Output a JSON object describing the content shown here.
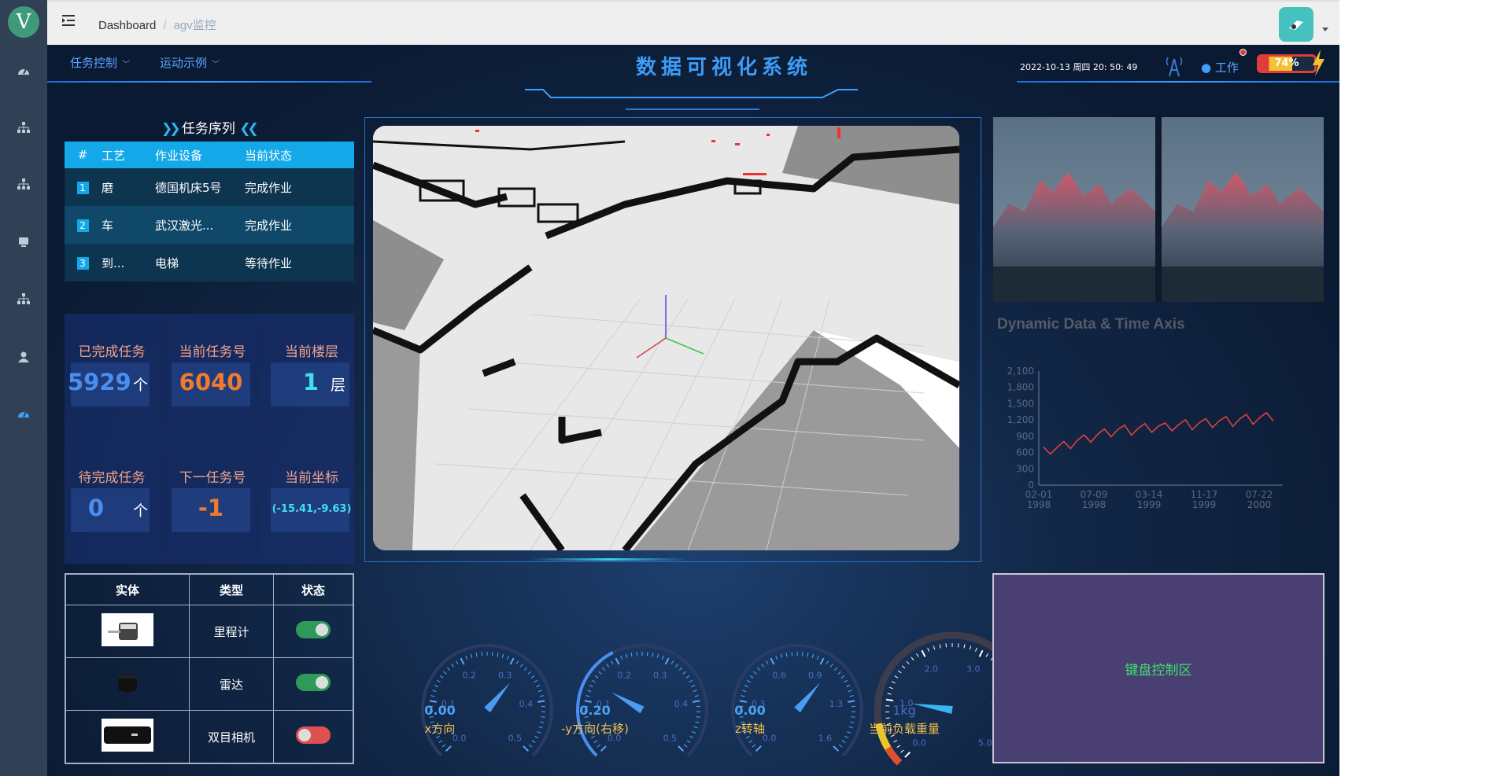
{
  "sidebar": {
    "logo_text": "V",
    "icons": [
      "dashboard-icon",
      "tree-icon",
      "tree-icon",
      "guide-icon",
      "tree-icon",
      "user-icon",
      "dashboard-icon"
    ]
  },
  "topbar": {
    "breadcrumb": [
      "Dashboard",
      "agv监控"
    ]
  },
  "header": {
    "menu_task": "任务控制",
    "menu_motion": "运动示例",
    "title": "数据可视化系统",
    "datetime": "2022-10-13 周四 20: 50: 49",
    "work_status": "工作",
    "battery": "74%",
    "battery_level": 0.74
  },
  "task_panel": {
    "title": "任务序列",
    "columns": [
      "#",
      "工艺",
      "作业设备",
      "当前状态"
    ],
    "rows": [
      {
        "no": "1",
        "process": "磨",
        "device": "德国机床5号",
        "status": "完成作业"
      },
      {
        "no": "2",
        "process": "车",
        "device": "武汉激光...",
        "status": "完成作业"
      },
      {
        "no": "3",
        "process": "到...",
        "device": "电梯",
        "status": "等待作业"
      }
    ]
  },
  "stats": {
    "completed_label": "已完成任务",
    "completed_value": "5929",
    "completed_unit": "个",
    "current_task_label": "当前任务号",
    "current_task_value": "6040",
    "floor_label": "当前楼层",
    "floor_value": "1",
    "floor_unit": "层",
    "pending_label": "待完成任务",
    "pending_value": "0",
    "pending_unit": "个",
    "next_task_label": "下一任务号",
    "next_task_value": "-1",
    "coord_label": "当前坐标",
    "coord_value": "(-15.41,-9.63)"
  },
  "sensors": {
    "columns": [
      "实体",
      "类型",
      "状态"
    ],
    "rows": [
      {
        "type": "里程计",
        "on": true
      },
      {
        "type": "雷达",
        "on": true
      },
      {
        "type": "双目相机",
        "on": false
      }
    ]
  },
  "gauges": [
    {
      "label": "x方向",
      "value": "0.00",
      "ticks": [
        "0.0",
        "0.1",
        "0.2",
        "0.3",
        "0.4",
        "0.5"
      ],
      "reading": 0.0
    },
    {
      "label": "-y方向(右移)",
      "value": "0.20",
      "ticks": [
        "0.0",
        "0.1",
        "0.2",
        "0.3",
        "0.4",
        "0.5"
      ],
      "reading": 0.2
    },
    {
      "label": "z转轴",
      "value": "0.00",
      "ticks": [
        "0.0",
        "0.3",
        "0.6",
        "0.9",
        "1.3",
        "1.6"
      ],
      "reading": 0.0
    },
    {
      "label": "当前负载重量",
      "value": "1kg",
      "ticks": [
        "0.0",
        "1.0",
        "2.0",
        "3.0",
        "4.0",
        "5.0"
      ],
      "reading": 1
    }
  ],
  "chart": {
    "title": "Dynamic Data & Time Axis",
    "chart_data": {
      "type": "line",
      "title": "Dynamic Data & Time Axis",
      "y_ticks": [
        "0",
        "300",
        "600",
        "900",
        "1,200",
        "1,500",
        "1,800",
        "2,100"
      ],
      "x_ticks": [
        "02-01\n1998",
        "07-09\n1998",
        "03-14\n1999",
        "11-17\n1999",
        "07-22\n2000"
      ],
      "ylim": [
        0,
        2100
      ],
      "series": [
        {
          "values": [
            600,
            640,
            660,
            700,
            740,
            790,
            820,
            860,
            900,
            930,
            960,
            990,
            1000,
            990,
            1010,
            1030,
            1040,
            1050,
            1040,
            1070,
            1080,
            1100,
            1090,
            1110,
            1120,
            1130,
            1150,
            1160,
            1150,
            1180,
            1200,
            1190,
            1210,
            1230,
            1250
          ]
        }
      ],
      "color": "#e04040"
    }
  },
  "keyboard_area": "键盘控制区"
}
